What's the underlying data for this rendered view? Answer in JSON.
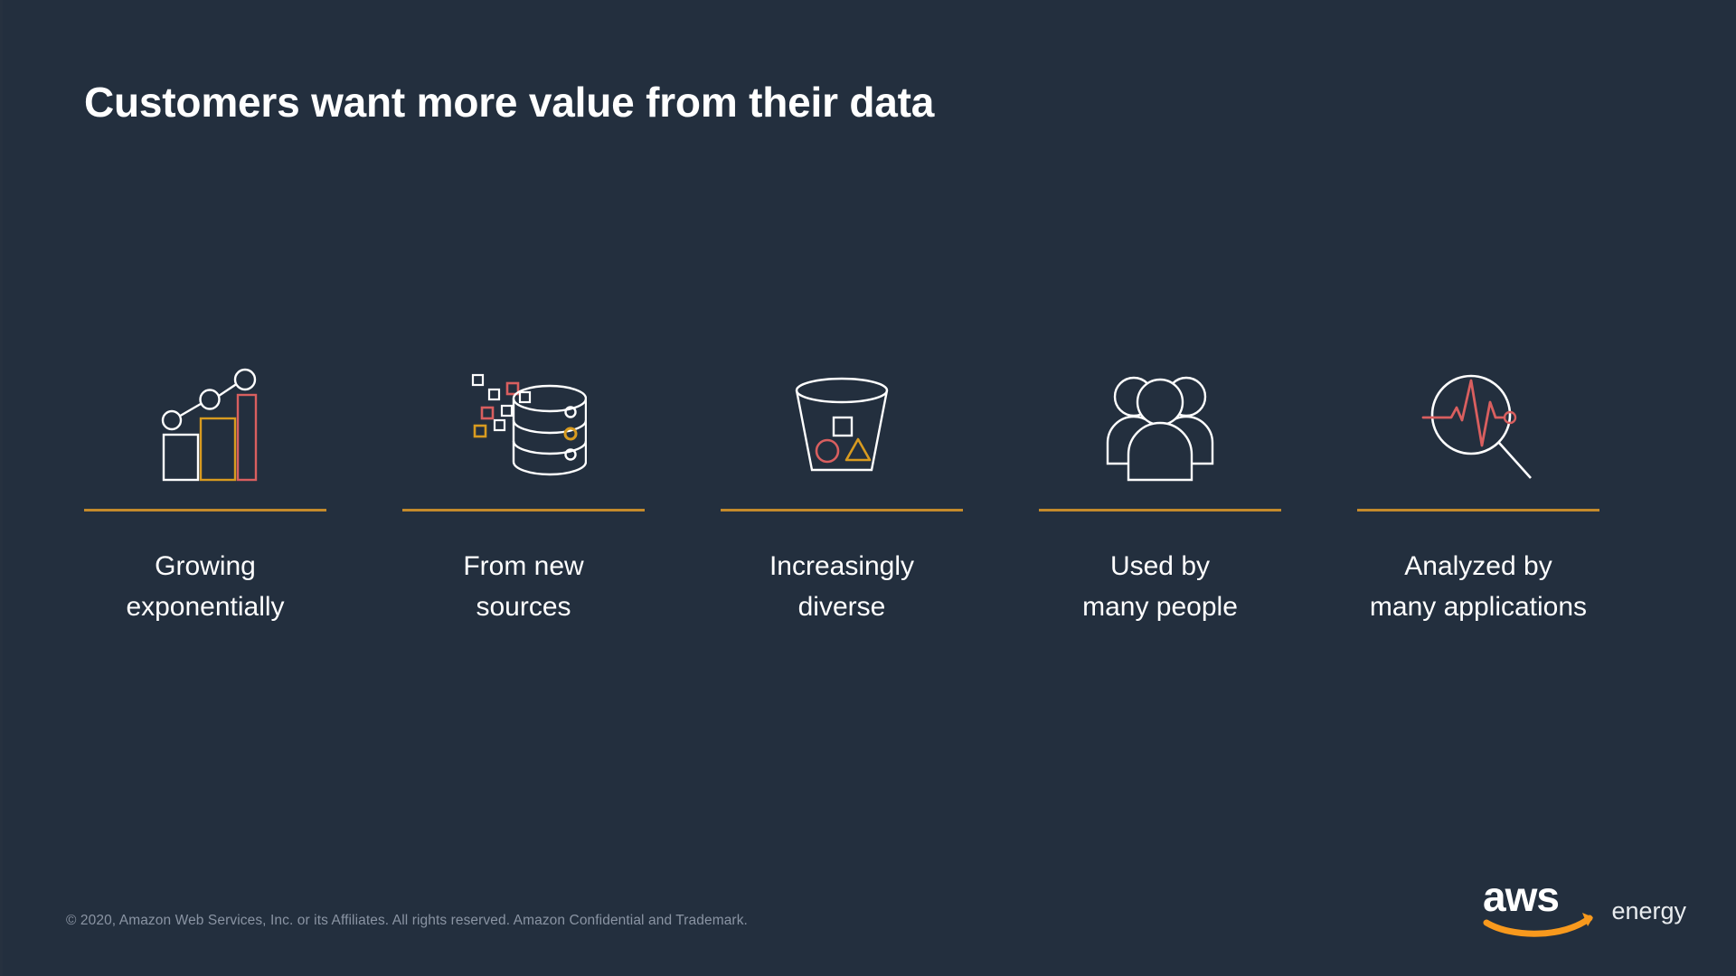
{
  "slide": {
    "title": "Customers want more value from their data",
    "background_color": "#232F3E",
    "accent_rule_color": "#C48A2B"
  },
  "columns": [
    {
      "icon": "growth-bar-chart-icon",
      "caption_line1": "Growing",
      "caption_line2": "exponentially",
      "icon_colors": [
        "#FFFFFF",
        "#D89B20",
        "#D95F5F"
      ]
    },
    {
      "icon": "database-ingest-icon",
      "caption_line1": "From new",
      "caption_line2": "sources",
      "icon_colors": [
        "#FFFFFF",
        "#D89B20",
        "#D95F5F"
      ]
    },
    {
      "icon": "data-bucket-icon",
      "caption_line1": "Increasingly",
      "caption_line2": "diverse",
      "icon_colors": [
        "#FFFFFF",
        "#D89B20",
        "#D95F5F"
      ]
    },
    {
      "icon": "people-group-icon",
      "caption_line1": "Used by",
      "caption_line2": "many people",
      "icon_colors": [
        "#FFFFFF"
      ]
    },
    {
      "icon": "magnifier-pulse-icon",
      "caption_line1": "Analyzed by",
      "caption_line2": "many applications",
      "icon_colors": [
        "#FFFFFF",
        "#D95F5F"
      ]
    }
  ],
  "footer": {
    "copyright": "© 2020, Amazon Web Services, Inc. or its Affiliates. All rights reserved. Amazon Confidential and Trademark.",
    "brand_mark": "aws-logo",
    "brand_word": "energy",
    "brand_swoosh_color": "#F8991D"
  }
}
